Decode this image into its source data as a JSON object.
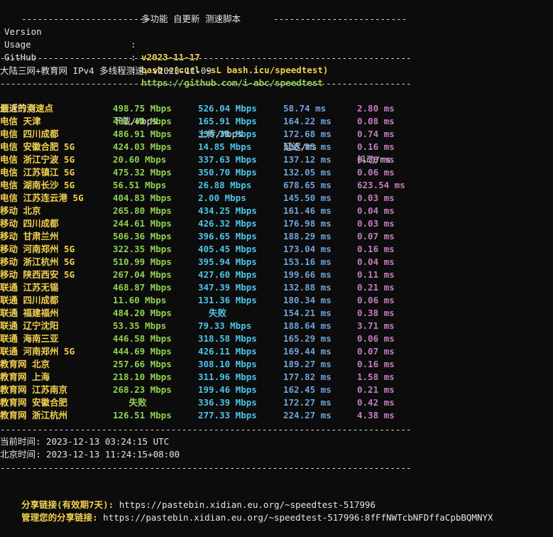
{
  "header": {
    "dashes_left": "------------------------",
    "title": "多功能 自更新 测速脚本",
    "dashes_right": "-------------------------"
  },
  "info": [
    {
      "key": "Version",
      "value": "v2023-11-17",
      "color": "yellow"
    },
    {
      "key": "Usage",
      "value": "bash <(curl -sL bash.icu/speedtest)",
      "color": "yellow"
    },
    {
      "key": "GitHub",
      "value": "https://github.com/i-abc/speedtest",
      "color": "green"
    }
  ],
  "separator": "-----------------------------------------------------------------------------",
  "test_title": "大陆三网+教育网 IPv4 多线程测速，v2023-11-09",
  "table": {
    "columns": [
      "测速节点",
      "下载/Mbps",
      "上传/Mbps",
      "延迟/ms",
      "抖动/ms"
    ],
    "rows": [
      {
        "node": "最近的测速点",
        "down": "498.75 Mbps",
        "up": "526.04 Mbps",
        "lat": "58.74 ms",
        "jit": "2.80 ms"
      },
      {
        "node": "电信 天津",
        "down": "481.40 Mbps",
        "up": "165.91 Mbps",
        "lat": "164.22 ms",
        "jit": "0.08 ms"
      },
      {
        "node": "电信 四川成都",
        "down": "486.91 Mbps",
        "up": "330.38 Mbps",
        "lat": "172.68 ms",
        "jit": "0.74 ms"
      },
      {
        "node": "电信 安徽合肥 5G",
        "down": "424.03 Mbps",
        "up": "14.85 Mbps",
        "lat": "138.85 ms",
        "jit": "0.16 ms"
      },
      {
        "node": "电信 浙江宁波 5G",
        "down": "20.60 Mbps",
        "up": "337.63 Mbps",
        "lat": "137.12 ms",
        "jit": "0.38 ms"
      },
      {
        "node": "电信 江苏镇江 5G",
        "down": "475.32 Mbps",
        "up": "350.70 Mbps",
        "lat": "132.05 ms",
        "jit": "0.06 ms"
      },
      {
        "node": "电信 湖南长沙 5G",
        "down": "56.51 Mbps",
        "up": "26.88 Mbps",
        "lat": "678.65 ms",
        "jit": "623.54 ms"
      },
      {
        "node": "电信 江苏连云港 5G",
        "down": "404.83 Mbps",
        "up": "2.00 Mbps",
        "lat": "145.50 ms",
        "jit": "0.03 ms"
      },
      {
        "node": "移动 北京",
        "down": "265.80 Mbps",
        "up": "434.25 Mbps",
        "lat": "161.46 ms",
        "jit": "0.04 ms"
      },
      {
        "node": "移动 四川成都",
        "down": "244.61 Mbps",
        "up": "426.32 Mbps",
        "lat": "176.98 ms",
        "jit": "0.03 ms"
      },
      {
        "node": "移动 甘肃兰州",
        "down": "506.36 Mbps",
        "up": "396.65 Mbps",
        "lat": "188.29 ms",
        "jit": "0.07 ms"
      },
      {
        "node": "移动 河南郑州 5G",
        "down": "322.35 Mbps",
        "up": "405.45 Mbps",
        "lat": "173.04 ms",
        "jit": "0.16 ms"
      },
      {
        "node": "移动 浙江杭州 5G",
        "down": "510.99 Mbps",
        "up": "395.94 Mbps",
        "lat": "153.16 ms",
        "jit": "0.04 ms"
      },
      {
        "node": "移动 陕西西安 5G",
        "down": "267.04 Mbps",
        "up": "427.60 Mbps",
        "lat": "199.66 ms",
        "jit": "0.11 ms"
      },
      {
        "node": "联通 江苏无锡",
        "down": "468.87 Mbps",
        "up": "347.39 Mbps",
        "lat": "132.88 ms",
        "jit": "0.21 ms"
      },
      {
        "node": "联通 四川成都",
        "down": "11.60 Mbps",
        "up": "131.36 Mbps",
        "lat": "180.34 ms",
        "jit": "0.06 ms"
      },
      {
        "node": "联通 福建福州",
        "down": "484.20 Mbps",
        "up": "  失败",
        "lat": "154.21 ms",
        "jit": "0.38 ms"
      },
      {
        "node": "联通 辽宁沈阳",
        "down": "53.35 Mbps",
        "up": "79.33 Mbps",
        "lat": "188.64 ms",
        "jit": "3.71 ms"
      },
      {
        "node": "联通 海南三亚",
        "down": "446.58 Mbps",
        "up": "318.58 Mbps",
        "lat": "165.29 ms",
        "jit": "0.06 ms"
      },
      {
        "node": "联通 河南郑州 5G",
        "down": "444.69 Mbps",
        "up": "426.11 Mbps",
        "lat": "169.44 ms",
        "jit": "0.07 ms"
      },
      {
        "node": "教育网 北京",
        "down": "257.66 Mbps",
        "up": "308.10 Mbps",
        "lat": "189.27 ms",
        "jit": "0.16 ms"
      },
      {
        "node": "教育网 上海",
        "down": "218.10 Mbps",
        "up": "311.96 Mbps",
        "lat": "177.82 ms",
        "jit": "1.58 ms"
      },
      {
        "node": "教育网 江苏南京",
        "down": "268.23 Mbps",
        "up": "199.46 Mbps",
        "lat": "162.45 ms",
        "jit": "0.21 ms"
      },
      {
        "node": "教育网 安徽合肥",
        "down": "   失败",
        "up": "336.39 Mbps",
        "lat": "172.27 ms",
        "jit": "0.42 ms"
      },
      {
        "node": "教育网 浙江杭州",
        "down": "126.51 Mbps",
        "up": "277.33 Mbps",
        "lat": "224.27 ms",
        "jit": "4.38 ms"
      }
    ]
  },
  "time": {
    "current": "当前时间: 2023-12-13 03:24:15 UTC",
    "beijing": "北京时间: 2023-12-13 11:24:15+08:00"
  },
  "share": {
    "label": "分享链接(有效期7天):",
    "url": " https://pastebin.xidian.eu.org/~speedtest-517996",
    "manage_label": "管理您的分享链接:",
    "manage_url": " https://pastebin.xidian.eu.org/~speedtest-517996:8fFfNWTcbNFDffaCpbBQMNYX"
  },
  "colors": {
    "background": "#0c0c0c",
    "node": "#f2d14e",
    "download": "#8fd152",
    "upload": "#4fc3e6",
    "latency": "#6fa3d8",
    "jitter": "#c57cc0"
  }
}
